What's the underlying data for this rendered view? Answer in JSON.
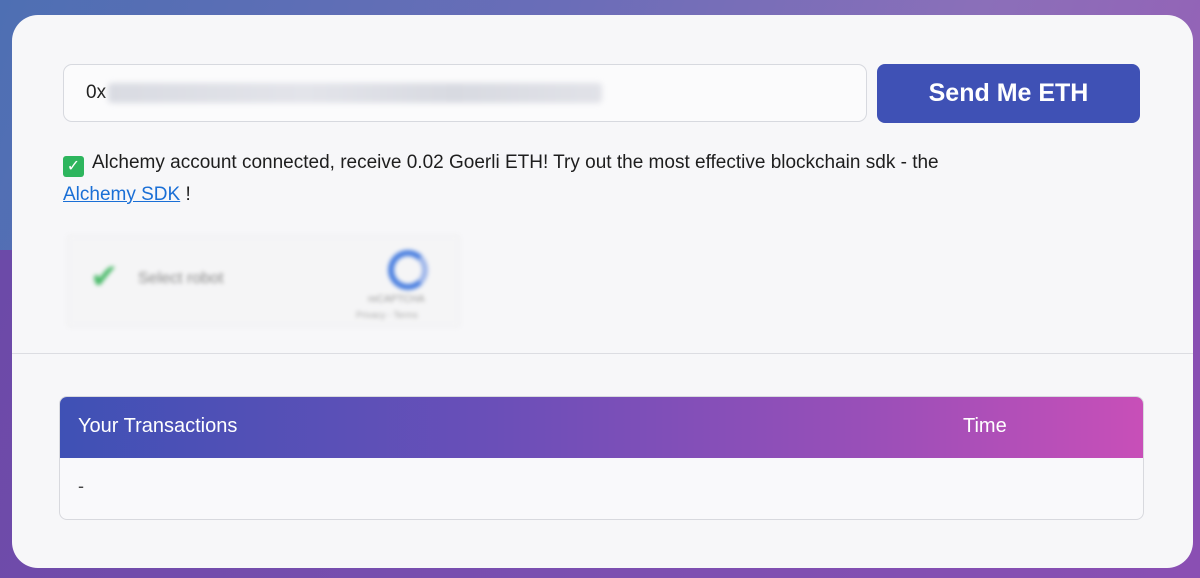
{
  "form": {
    "address_prefix": "0x",
    "send_button_label": "Send Me ETH"
  },
  "status": {
    "check_icon": "checkmark-icon",
    "message": "Alchemy account connected, receive 0.02 Goerli ETH! Try out the most effective blockchain sdk - the",
    "link_text": "Alchemy SDK",
    "suffix": " !"
  },
  "captcha": {
    "label": "Select robot",
    "brand": "reCAPTCHA",
    "terms": "Privacy - Terms"
  },
  "transactions": {
    "headers": [
      "Your Transactions",
      "Time"
    ],
    "rows": [
      [
        "-",
        ""
      ]
    ]
  },
  "colors": {
    "accent": "#3f51b5",
    "gradient_end": "#c84fb8",
    "success": "#2db55d",
    "link": "#1a6fd6"
  }
}
